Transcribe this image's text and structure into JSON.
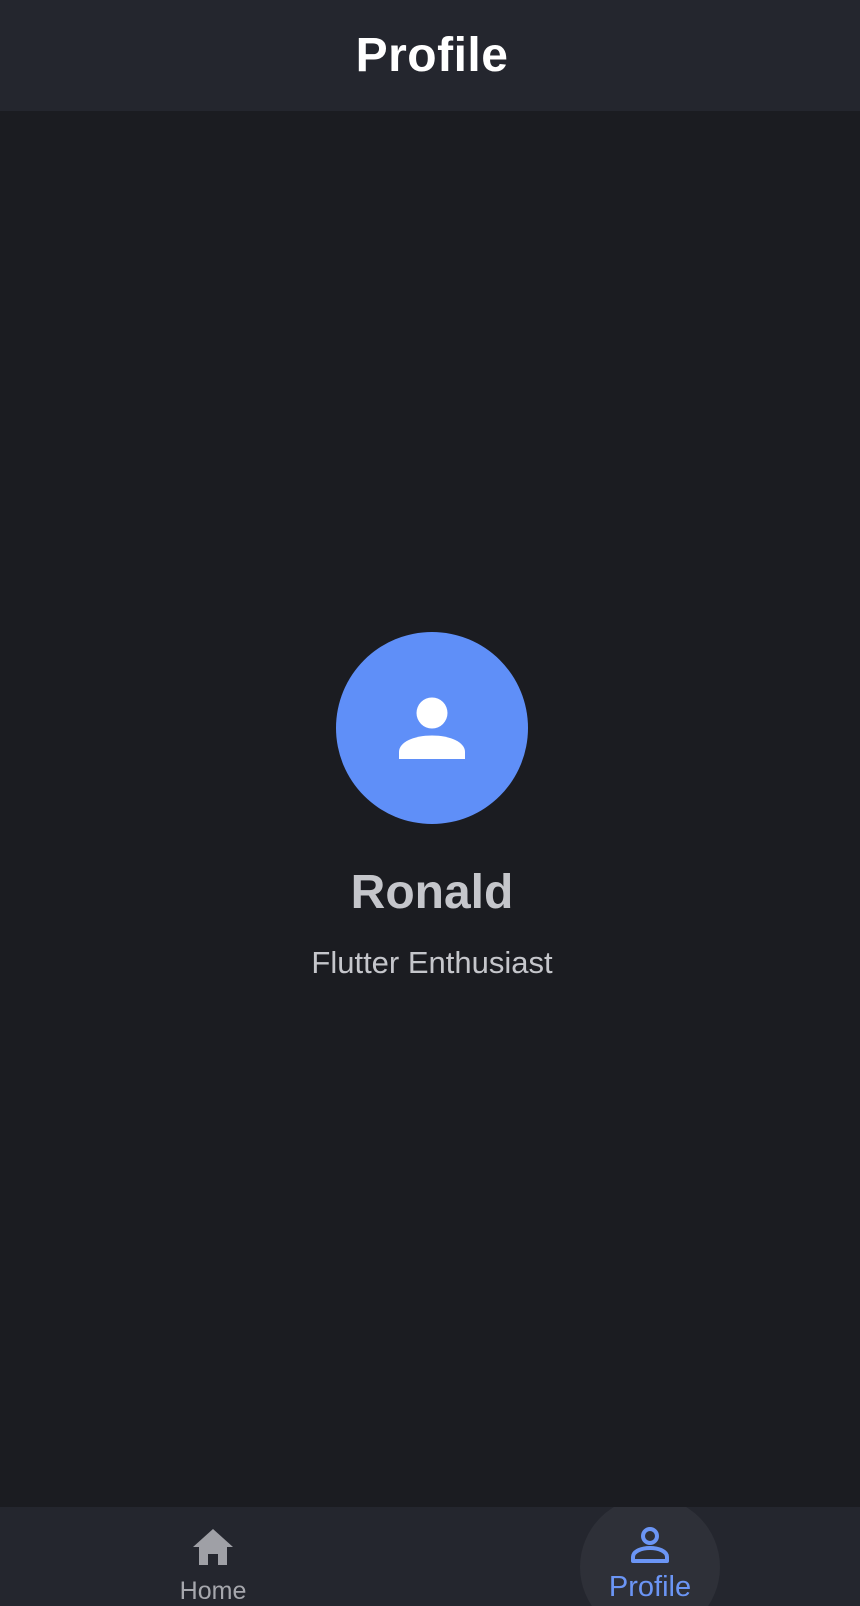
{
  "app_bar": {
    "title": "Profile"
  },
  "profile": {
    "avatar_icon": "person-icon",
    "name": "Ronald",
    "subtitle": "Flutter Enthusiast"
  },
  "bottom_nav": {
    "selected": "profile",
    "items": [
      {
        "id": "home",
        "label": "Home",
        "icon": "home-icon"
      },
      {
        "id": "profile",
        "label": "Profile",
        "icon": "person-outline-icon"
      }
    ]
  },
  "colors": {
    "background": "#1b1c21",
    "app_bar": "#24262e",
    "accent": "#5f8ff8",
    "selected_label": "#6b95f5",
    "text_secondary": "#c5c6cb",
    "nav_inactive": "#a6a7ad"
  }
}
